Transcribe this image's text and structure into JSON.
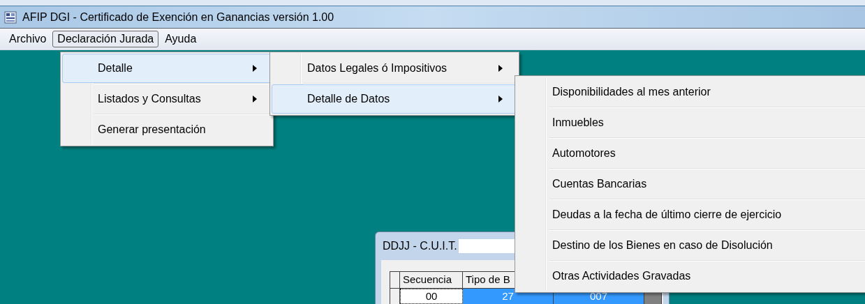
{
  "window": {
    "title": "AFIP DGI - Certificado de Exención en Ganancias versión 1.00"
  },
  "menu_bar": [
    {
      "label": "Archivo",
      "selected": false
    },
    {
      "label": "Declaración Jurada",
      "selected": true
    },
    {
      "label": "Ayuda",
      "selected": false
    }
  ],
  "menus": [
    {
      "items": [
        {
          "label": "Detalle",
          "submenu": true,
          "selected": true
        },
        {
          "label": "Listados y Consultas",
          "submenu": true,
          "selected": false
        },
        {
          "label": "Generar presentación",
          "submenu": false,
          "selected": false
        }
      ]
    },
    {
      "items": [
        {
          "label": "Datos Legales ó Impositivos",
          "submenu": true,
          "selected": false
        },
        {
          "label": "Detalle de Datos",
          "submenu": true,
          "selected": true
        }
      ]
    },
    {
      "items": [
        {
          "label": "Disponibilidades al mes anterior",
          "submenu": false,
          "selected": false
        },
        {
          "label": "Inmuebles",
          "submenu": false,
          "selected": false
        },
        {
          "label": "Automotores",
          "submenu": false,
          "selected": false
        },
        {
          "label": "Cuentas Bancarias",
          "submenu": false,
          "selected": false
        },
        {
          "label": "Deudas a la fecha de último cierre de ejercicio",
          "submenu": false,
          "selected": false
        },
        {
          "label": "Destino de los Bienes en caso de Disolución",
          "submenu": false,
          "selected": false
        },
        {
          "label": "Otras Actividades Gravadas",
          "submenu": false,
          "selected": false
        }
      ]
    }
  ],
  "child_window": {
    "title": "DDJJ - C.U.I.T.",
    "table": {
      "columns": [
        "Secuencia",
        "Tipo de B"
      ],
      "rows": [
        {
          "cells": [
            {
              "text": "00",
              "selected": false
            },
            {
              "text": "27",
              "selected": true
            },
            {
              "text": "007",
              "selected": true
            }
          ]
        }
      ]
    }
  }
}
